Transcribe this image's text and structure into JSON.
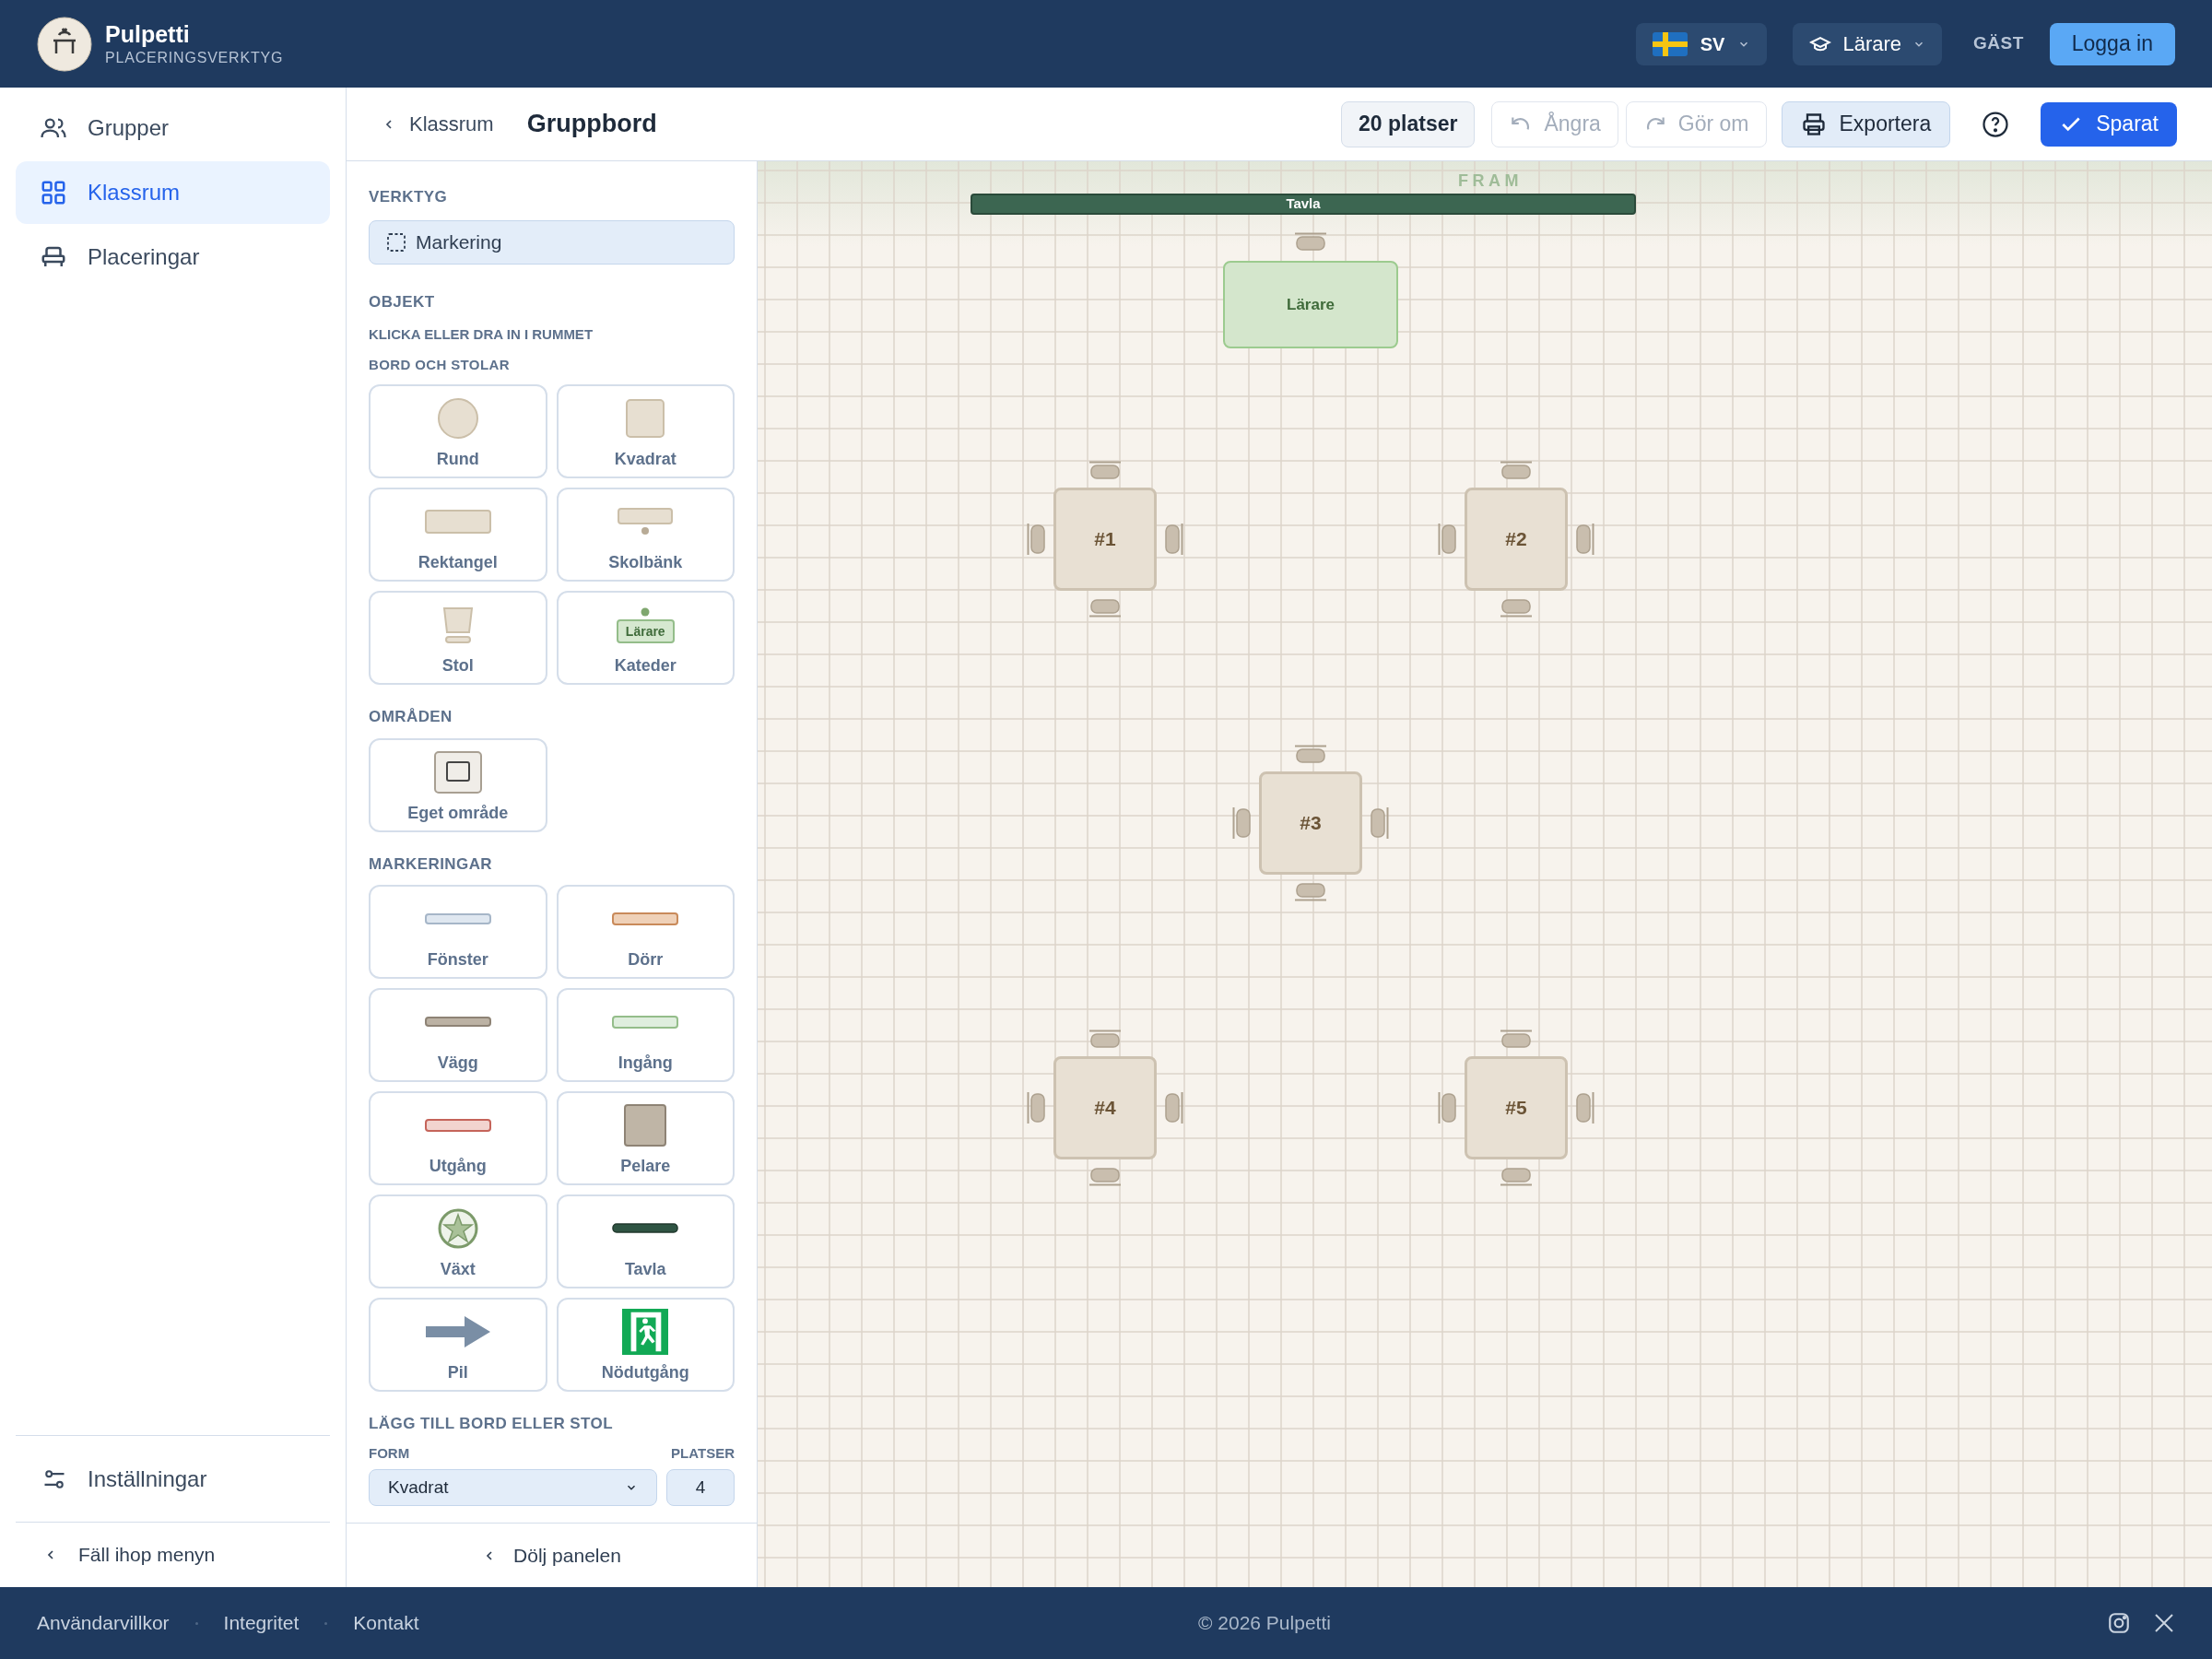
{
  "header": {
    "app_name": "Pulpetti",
    "subtitle": "PLACERINGSVERKTYG",
    "language": "SV",
    "role": "Lärare",
    "guest": "GÄST",
    "login": "Logga in"
  },
  "sidebar": {
    "items": [
      {
        "label": "Grupper",
        "kind": "groups",
        "selected": false
      },
      {
        "label": "Klassrum",
        "kind": "rooms",
        "selected": true
      },
      {
        "label": "Placeringar",
        "kind": "seating",
        "selected": false
      }
    ],
    "settings": "Inställningar",
    "collapse": "Fäll ihop menyn"
  },
  "toolbar": {
    "back": "Klassrum",
    "title": "Gruppbord",
    "seats": "20 platser",
    "undo": {
      "label": "Ångra",
      "disabled": true
    },
    "redo": {
      "label": "Gör om",
      "disabled": true
    },
    "export": "Exportera",
    "saved": "Sparat"
  },
  "panel": {
    "tools_heading": "VERKTYG",
    "tool": {
      "label": "Markering",
      "selected": true
    },
    "objects_heading": "OBJEKT",
    "objects_hint": "KLICKA ELLER DRA IN I RUMMET",
    "groups": [
      {
        "heading": "BORD OCH STOLAR",
        "items": [
          {
            "label": "Rund",
            "kind": "round"
          },
          {
            "label": "Kvadrat",
            "kind": "square"
          },
          {
            "label": "Rektangel",
            "kind": "rect"
          },
          {
            "label": "Skolbänk",
            "kind": "desk"
          },
          {
            "label": "Stol",
            "kind": "chair"
          },
          {
            "label": "Kateder",
            "kind": "teacher"
          }
        ],
        "teacher_tag": "Lärare"
      },
      {
        "heading": "OMRÅDEN",
        "items": [
          {
            "label": "Eget område",
            "kind": "area"
          }
        ]
      },
      {
        "heading": "MARKERINGAR",
        "items": [
          {
            "label": "Fönster",
            "kind": "window"
          },
          {
            "label": "Dörr",
            "kind": "door"
          },
          {
            "label": "Vägg",
            "kind": "wall"
          },
          {
            "label": "Ingång",
            "kind": "entrance"
          },
          {
            "label": "Utgång",
            "kind": "exit"
          },
          {
            "label": "Pelare",
            "kind": "pillar"
          },
          {
            "label": "Växt",
            "kind": "plant"
          },
          {
            "label": "Tavla",
            "kind": "board"
          },
          {
            "label": "Pil",
            "kind": "arrow"
          },
          {
            "label": "Nödutgång",
            "kind": "emergency"
          }
        ]
      }
    ],
    "add_heading": "LÄGG TILL BORD ELLER STOL",
    "form_label": "FORM",
    "seats_label": "PLATSER",
    "form_value": "Kvadrat",
    "seats_value": "4",
    "hide": "Dölj panelen"
  },
  "canvas": {
    "front_label": "FRAM",
    "objects": [
      {
        "kind": "board",
        "label": "Tavla"
      },
      {
        "kind": "desk",
        "label": "Lärare"
      },
      {
        "kind": "table",
        "label": "#1"
      },
      {
        "kind": "table",
        "label": "#2"
      },
      {
        "kind": "table",
        "label": "#3"
      },
      {
        "kind": "table",
        "label": "#4"
      },
      {
        "kind": "table",
        "label": "#5"
      }
    ]
  },
  "footer": {
    "links": [
      "Användarvillkor",
      "Integritet",
      "Kontakt"
    ],
    "copyright": "© 2026 Pulpetti"
  }
}
